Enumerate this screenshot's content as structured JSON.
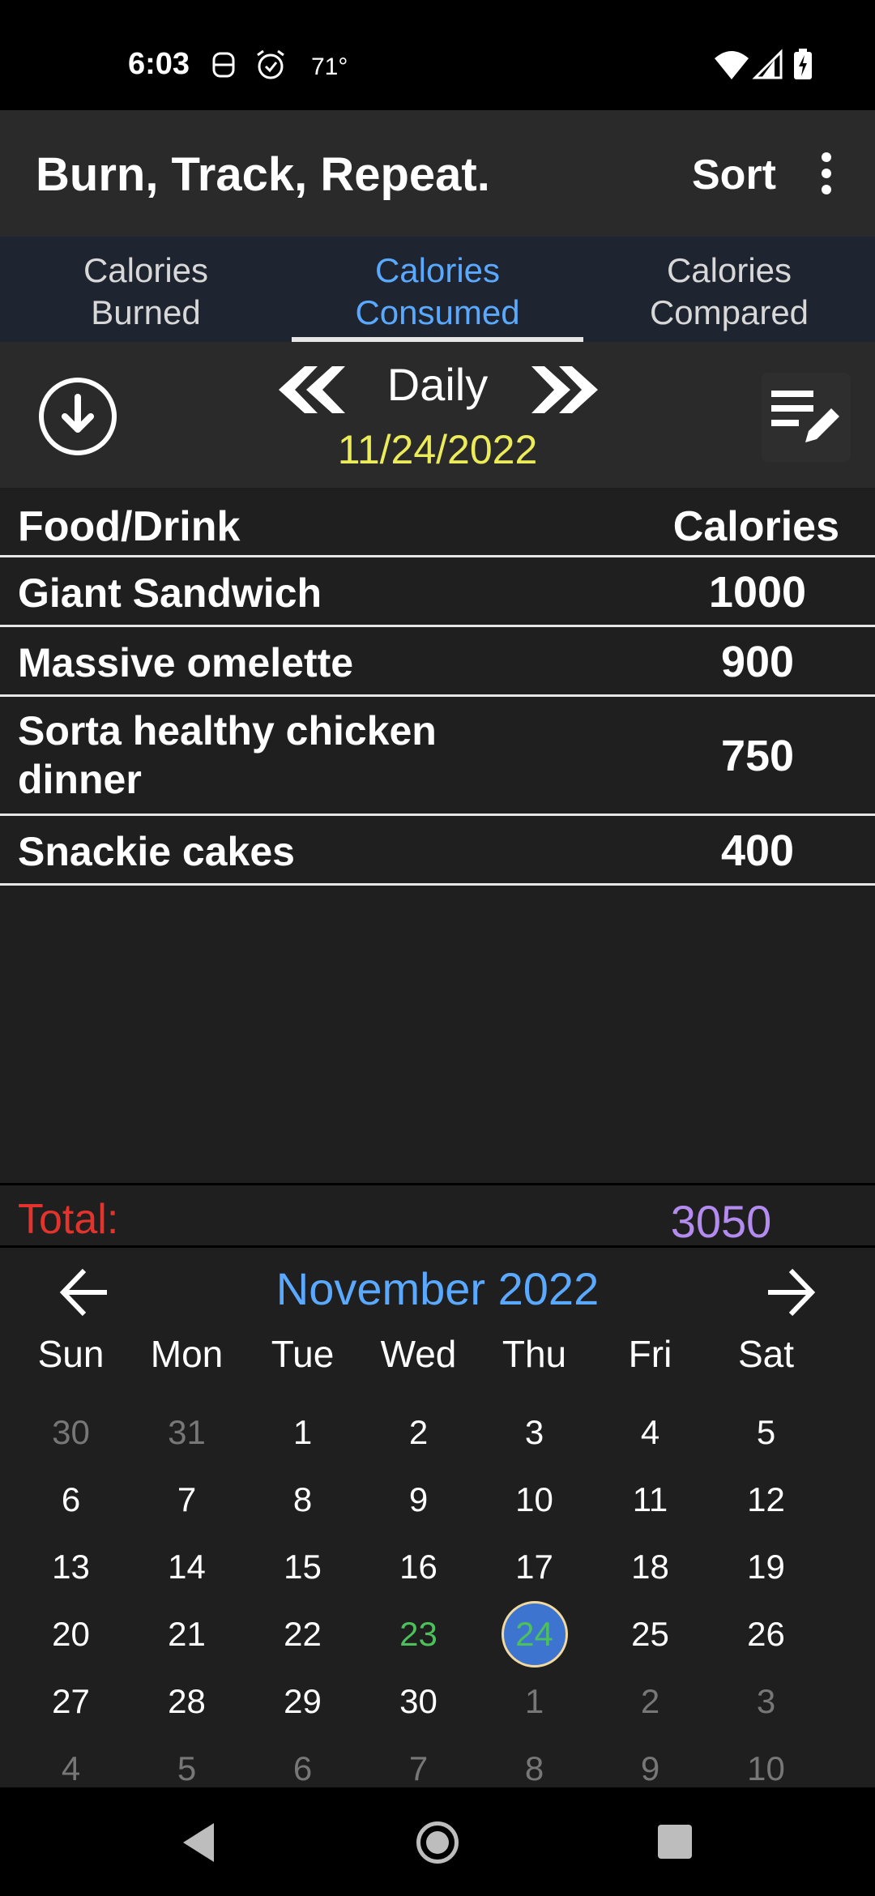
{
  "status_bar": {
    "time": "6:03",
    "temperature": "71°"
  },
  "app_bar": {
    "title": "Burn, Track, Repeat.",
    "sort_label": "Sort"
  },
  "tabs": [
    {
      "line1": "Calories",
      "line2": "Burned"
    },
    {
      "line1": "Calories",
      "line2": "Consumed"
    },
    {
      "line1": "Calories",
      "line2": "Compared"
    }
  ],
  "controls": {
    "period": "Daily",
    "date": "11/24/2022"
  },
  "table": {
    "header_name": "Food/Drink",
    "header_calories": "Calories",
    "rows": [
      {
        "name": "Giant Sandwich",
        "calories": "1000"
      },
      {
        "name": "Massive omelette",
        "calories": "900"
      },
      {
        "name": "Sorta healthy chicken dinner",
        "calories": "750"
      },
      {
        "name": "Snackie cakes",
        "calories": "400"
      }
    ]
  },
  "total": {
    "label": "Total:",
    "value": "3050"
  },
  "calendar": {
    "month": "November 2022",
    "weekdays": [
      "Sun",
      "Mon",
      "Tue",
      "Wed",
      "Thu",
      "Fri",
      "Sat"
    ],
    "days": [
      "30",
      "31",
      "1",
      "2",
      "3",
      "4",
      "5",
      "6",
      "7",
      "8",
      "9",
      "10",
      "11",
      "12",
      "13",
      "14",
      "15",
      "16",
      "17",
      "18",
      "19",
      "20",
      "21",
      "22",
      "23",
      "24",
      "25",
      "26",
      "27",
      "28",
      "29",
      "30",
      "1",
      "2",
      "3",
      "4",
      "5",
      "6",
      "7",
      "8",
      "9",
      "10"
    ],
    "today_day": "23",
    "selected_day": "24"
  },
  "colors": {
    "accent_blue": "#5aa9ff",
    "date_yellow": "#ecec5a",
    "total_red": "#e2342c",
    "total_purple": "#b48cf0",
    "today_green": "#4cc05a",
    "selected_blue": "#3d74d0"
  },
  "icons": {
    "status": [
      "alarm-icon",
      "wifi-icon",
      "signal-icon",
      "battery-charging-icon"
    ],
    "controls": [
      "download-icon",
      "double-chevron-left-icon",
      "double-chevron-right-icon",
      "edit-list-icon"
    ],
    "calendar": [
      "arrow-left-icon",
      "arrow-right-icon"
    ],
    "nav": [
      "back-icon",
      "home-icon",
      "recents-icon"
    ]
  }
}
